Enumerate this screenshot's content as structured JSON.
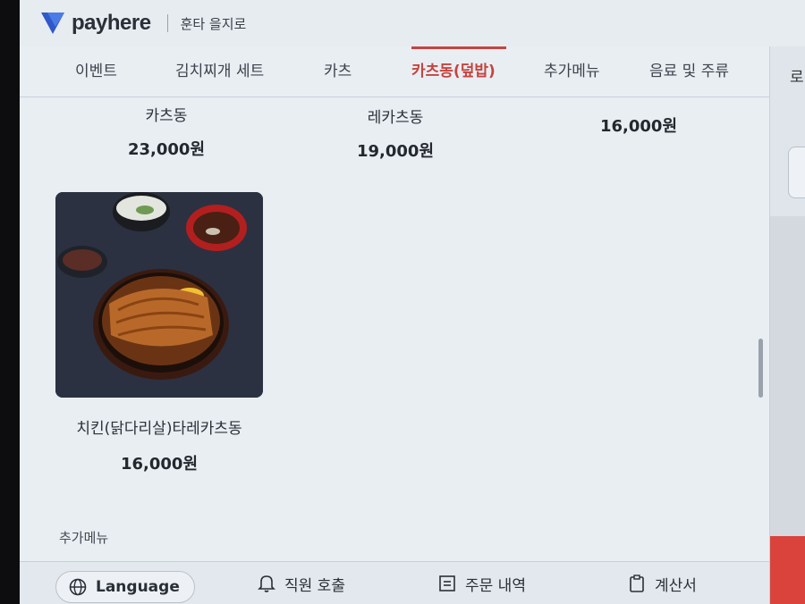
{
  "header": {
    "logo_text": "payhere",
    "store_name": "훈타 을지로"
  },
  "tabs": [
    {
      "label": "이벤트"
    },
    {
      "label": "김치찌개 세트"
    },
    {
      "label": "카츠"
    },
    {
      "label": "카츠동(덮밥)",
      "active": true
    },
    {
      "label": "추가메뉴"
    },
    {
      "label": "음료 및 주류"
    }
  ],
  "right_panel": {
    "label": "로"
  },
  "menu_items": [
    {
      "name": "카츠동",
      "price": "23,000원"
    },
    {
      "name": "레카츠동",
      "price": "19,000원"
    },
    {
      "name": "",
      "price": "16,000원"
    },
    {
      "name": "치킨(닭다리살)타레카츠동",
      "price": "16,000원",
      "image": "katsudon-photo"
    }
  ],
  "section": {
    "next_label": "추가메뉴"
  },
  "footer": {
    "language_label": "Language",
    "call_staff_label": "직원 호출",
    "order_history_label": "주문 내역",
    "bill_label": "계산서"
  },
  "colors": {
    "accent": "#c4453f",
    "brand": "#2f58c9"
  }
}
